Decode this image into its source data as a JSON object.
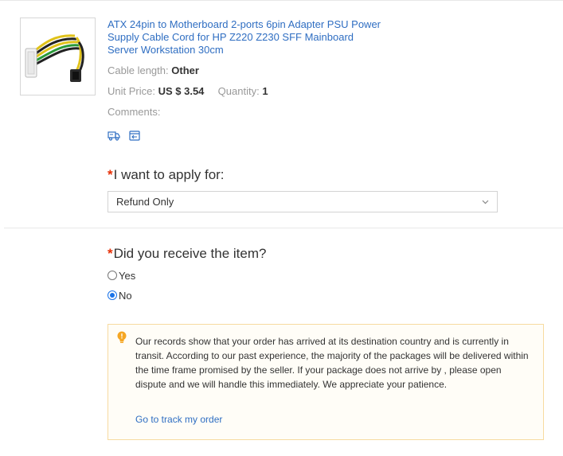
{
  "product": {
    "title": "ATX 24pin to Motherboard 2-ports 6pin Adapter PSU Power Supply Cable Cord for HP Z220 Z230 SFF Mainboard Server Workstation 30cm",
    "cable_length_label": "Cable length:",
    "cable_length_value": "Other",
    "unit_price_label": "Unit Price:",
    "unit_price_value": "US $ 3.54",
    "quantity_label": "Quantity:",
    "quantity_value": "1",
    "comments_label": "Comments:",
    "icons": [
      "shipping-truck-icon",
      "return-box-icon"
    ]
  },
  "apply_for": {
    "required_mark": "*",
    "label": "I want to apply for:",
    "selected": "Refund Only"
  },
  "received": {
    "required_mark": "*",
    "label": "Did you receive the item?",
    "options": [
      {
        "label": "Yes",
        "checked": false
      },
      {
        "label": "No",
        "checked": true
      }
    ]
  },
  "notice": {
    "icon": "lightbulb-icon",
    "text": "Our records show that your order has arrived at its destination country and is currently in transit. According to our past experience, the majority of the packages will be delivered within the time frame promised by the seller. If your package does not arrive by , please open dispute and we will handle this immediately. We appreciate your patience.",
    "link": "Go to track my order"
  },
  "colors": {
    "link": "#2f6ec2",
    "required": "#e62e04",
    "radio_checked": "#1a73e8",
    "notice_border": "#f7dba0",
    "notice_icon": "#f5a623"
  }
}
